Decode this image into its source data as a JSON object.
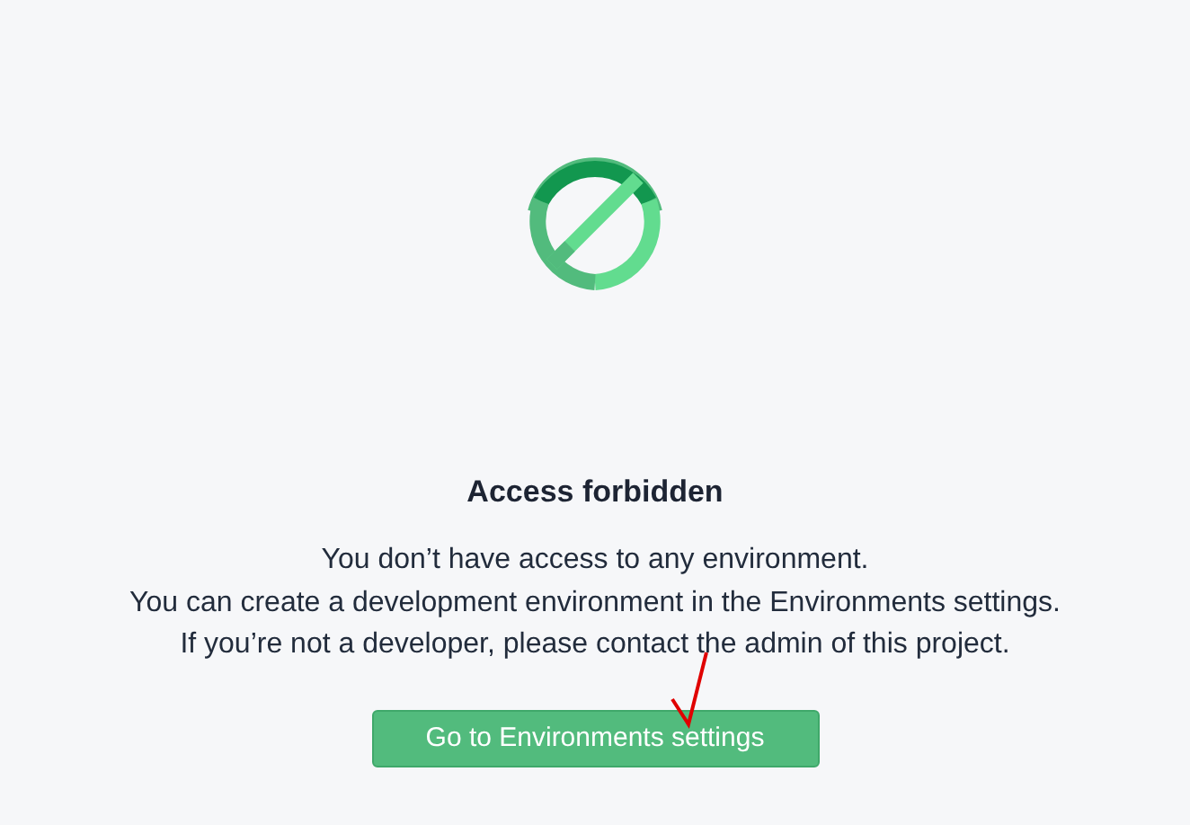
{
  "title": "Access forbidden",
  "message_lines": [
    "You don’t have access to any environment.",
    "You can create a development environment in the Environments settings.",
    "If you’re not a developer, please contact the admin of this project."
  ],
  "button": {
    "label": "Go to Environments settings"
  }
}
